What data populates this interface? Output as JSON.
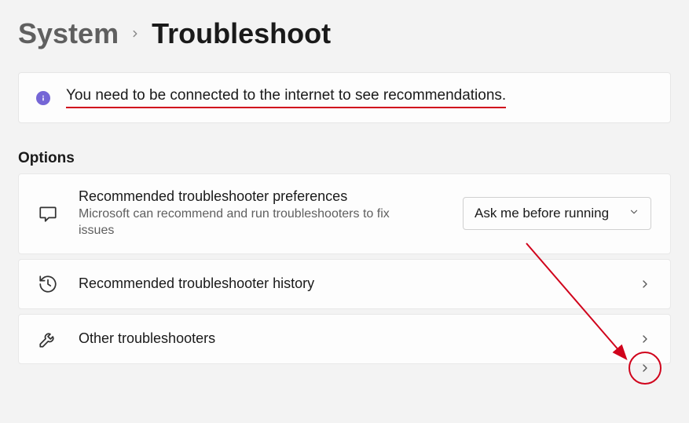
{
  "breadcrumb": {
    "parent": "System",
    "current": "Troubleshoot"
  },
  "banner": {
    "text": "You need to be connected to the internet to see recommendations."
  },
  "options": {
    "heading": "Options",
    "pref": {
      "title": "Recommended troubleshooter preferences",
      "desc": "Microsoft can recommend and run troubleshooters to fix issues",
      "selected": "Ask me before running"
    },
    "history": {
      "title": "Recommended troubleshooter history"
    },
    "other": {
      "title": "Other troubleshooters"
    }
  }
}
